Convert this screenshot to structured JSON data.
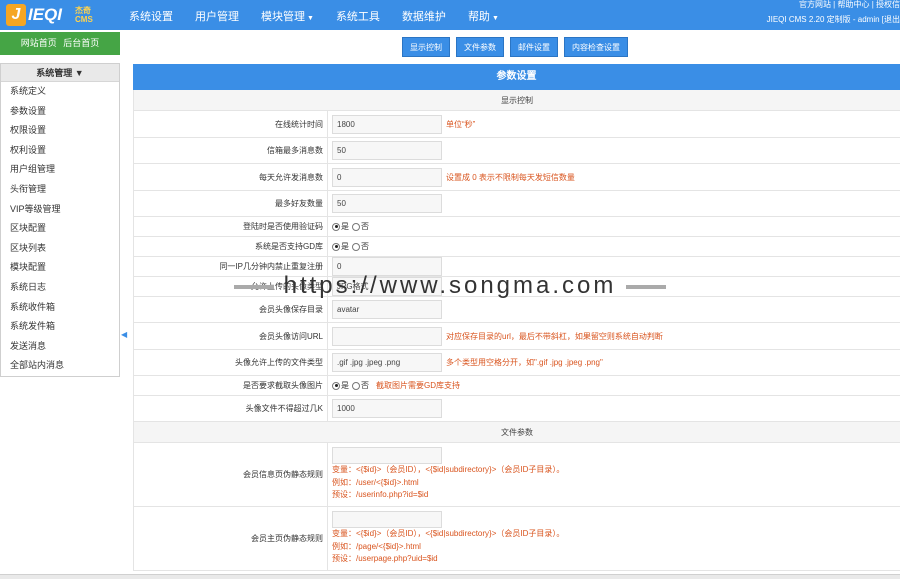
{
  "logo": {
    "letter": "J",
    "brand": "IEQI",
    "sub_top": "杰奇",
    "sub_bottom": "CMS"
  },
  "nav": [
    {
      "label": "系统设置",
      "dropdown": false
    },
    {
      "label": "用户管理",
      "dropdown": false
    },
    {
      "label": "模块管理",
      "dropdown": true
    },
    {
      "label": "系统工具",
      "dropdown": false
    },
    {
      "label": "数据维护",
      "dropdown": false
    },
    {
      "label": "帮助",
      "dropdown": true
    }
  ],
  "toplinks": "官方网站 | 帮助中心 | 授权信",
  "sysinfo": "JIEQI CMS 2.20 定制版 - admin [退出",
  "sidebar": {
    "home_label": "网站首页  后台首页",
    "menu_title": "系统管理",
    "items": [
      "系统定义",
      "参数设置",
      "权限设置",
      "权利设置",
      "用户组管理",
      "头衔管理",
      "VIP等级管理",
      "区块配置",
      "区块列表",
      "模块配置",
      "系统日志",
      "系统收件箱",
      "系统发件箱",
      "发送消息",
      "全部站内消息"
    ]
  },
  "tabs": [
    "显示控制",
    "文件参数",
    "邮件设置",
    "内容检查设置"
  ],
  "page_title": "参数设置",
  "sections": {
    "display": "显示控制",
    "files": "文件参数"
  },
  "rows": [
    {
      "label": "在线统计时间",
      "value": "1800",
      "note": "单位“秒”"
    },
    {
      "label": "信箱最多消息数",
      "value": "50",
      "note": ""
    },
    {
      "label": "每天允许发消息数",
      "value": "0",
      "note": "设置成 0 表示不限制每天发短信数量"
    },
    {
      "label": "最多好友数量",
      "value": "50",
      "note": ""
    },
    {
      "label": "登陆时是否使用验证码",
      "radio": [
        "是",
        "否"
      ],
      "note": ""
    },
    {
      "label": "系统是否支持GD库",
      "radio": [
        "是",
        "否"
      ],
      "note": ""
    },
    {
      "label": "同一IP几分钟内禁止重复注册",
      "value": "0",
      "note": ""
    },
    {
      "label": "允许上传的头像类型",
      "value": "JPG格式",
      "note": ""
    },
    {
      "label": "会员头像保存目录",
      "value": "avatar",
      "note": ""
    },
    {
      "label": "会员头像访问URL",
      "value": "",
      "note": "对应保存目录的url，最后不带斜杠，如果留空则系统自动判断"
    },
    {
      "label": "头像允许上传的文件类型",
      "value": ".gif .jpg .jpeg .png",
      "note": "多个类型用空格分开，如\".gif .jpg .jpeg .png\""
    },
    {
      "label": "是否要求截取头像图片",
      "radio": [
        "是",
        "否"
      ],
      "note": "截取图片需要GD库支持"
    },
    {
      "label": "头像文件不得超过几K",
      "value": "1000",
      "note": ""
    }
  ],
  "file_rows": [
    {
      "label": "会员信息页伪静态规则",
      "lines": [
        "变量：<{$id}>（会员ID），<{$id|subdirectory}>（会员ID子目录）。",
        "例如：/user/<{$id}>.html",
        "预设：/userinfo.php?id=$id"
      ]
    },
    {
      "label": "会员主页伪静态规则",
      "lines": [
        "变量：<{$id}>（会员ID），<{$id|subdirectory}>（会员ID子目录）。",
        "例如：/page/<{$id}>.html",
        "预设：/userpage.php?uid=$id"
      ]
    }
  ],
  "watermark": "https://www.songma.com",
  "colors": {
    "topbar": "#3a8ee6",
    "home_button": "#45a545",
    "note": "#d9541e"
  }
}
